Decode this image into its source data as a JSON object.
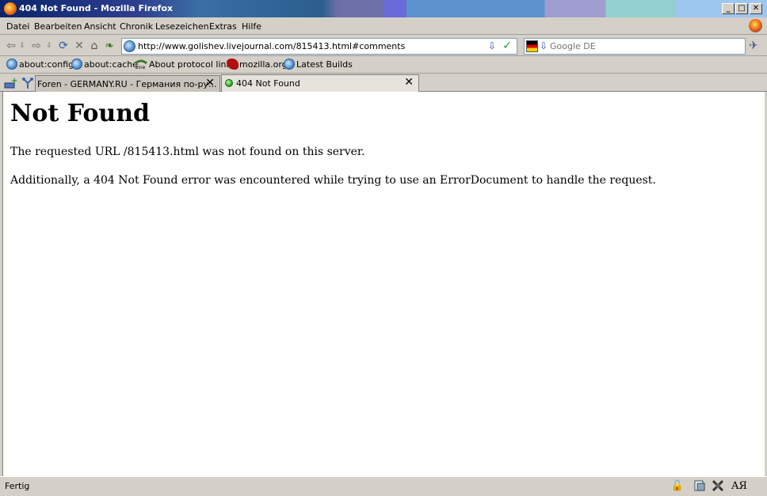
{
  "window": {
    "title": "404 Not Found - Mozilla Firefox",
    "minimize_label": "_",
    "maximize_label": "□",
    "close_label": "✕"
  },
  "menu": {
    "items": [
      "Datei",
      "Bearbeiten",
      "Ansicht",
      "Chronik",
      "Lesezeichen",
      "Extras",
      "Hilfe"
    ]
  },
  "navigation": {
    "url": "http://www.golishev.livejournal.com/815413.html#comments",
    "search_placeholder": "Google DE",
    "icons": [
      "back-icon",
      "forward-icon",
      "reload-icon",
      "stop-icon",
      "home-icon"
    ]
  },
  "bookmarks": {
    "items": [
      "about:config",
      "about:cache",
      "About protocol links",
      "mozilla.org",
      "Latest Builds"
    ]
  },
  "tabs": {
    "items": [
      {
        "label": "Foren - GERMANY.RU - Германия по-ру..."
      },
      {
        "label": "404 Not Found"
      }
    ],
    "close_label": "✕"
  },
  "page": {
    "heading": "Not Found",
    "message1": "The requested URL /815413.html was not found on this server.",
    "message2": "Additionally, a 404 Not Found error was encountered while trying to use an ErrorDocument to handle the request."
  },
  "status": {
    "text": "Fertig",
    "translit_label": "AЯ"
  }
}
